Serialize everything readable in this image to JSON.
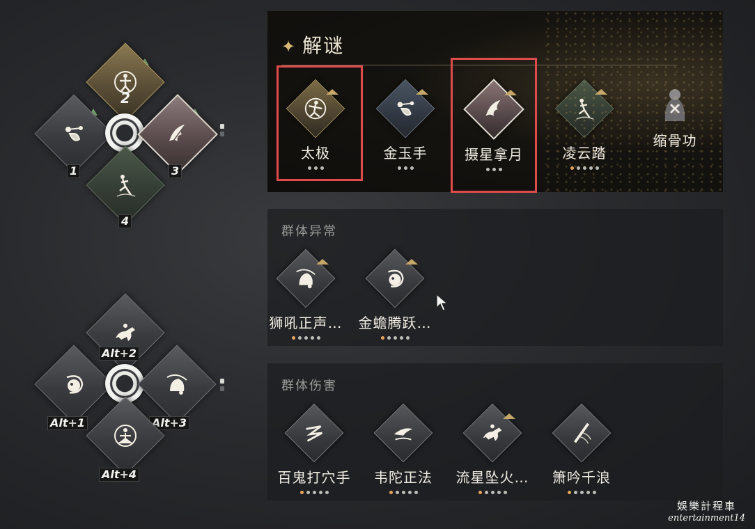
{
  "wheel_top": {
    "slots": [
      {
        "key": "2",
        "icon": "archer-icon",
        "style": "gold"
      },
      {
        "key": "1",
        "icon": "grab-hand-icon",
        "style": "grey"
      },
      {
        "key": "3",
        "icon": "feather-wing-icon",
        "style": "rose"
      },
      {
        "key": "4",
        "icon": "leap-figure-icon",
        "style": "green"
      }
    ]
  },
  "wheel_bottom": {
    "slots": [
      {
        "mod": "Alt",
        "plus": "+",
        "key": "2",
        "icon": "horse-rider-icon"
      },
      {
        "mod": "Alt",
        "plus": "+",
        "key": "1",
        "icon": "spiral-spirit-icon"
      },
      {
        "mod": "Alt",
        "plus": "+",
        "key": "3",
        "icon": "bell-roar-icon"
      },
      {
        "mod": "Alt",
        "plus": "+",
        "key": "4",
        "icon": "seated-monk-icon"
      }
    ]
  },
  "puzzle": {
    "title": "解谜",
    "skills": [
      {
        "name": "太极",
        "icon": "taichi-figure-icon",
        "style": "gold",
        "dots": 3,
        "lit": 0,
        "highlighted": true
      },
      {
        "name": "金玉手",
        "icon": "grab-hand-icon",
        "style": "blue",
        "dots": 3,
        "lit": 0,
        "highlighted": false
      },
      {
        "name": "摄星拿月",
        "icon": "feather-wing-icon",
        "style": "rose",
        "dots": 3,
        "lit": 0,
        "highlighted": true
      },
      {
        "name": "凌云踏",
        "icon": "leap-figure-icon",
        "style": "green",
        "dots": 5,
        "lit": 1,
        "highlighted": false
      },
      {
        "name": "缩骨功",
        "icon": "bone-shrink-icon",
        "style": "grey",
        "dots": 0,
        "lit": 0,
        "highlighted": false
      }
    ]
  },
  "group_abnormal": {
    "title": "群体异常",
    "skills": [
      {
        "name": "狮吼正声…",
        "icon": "bell-roar-icon",
        "style": "grey",
        "dots": 5,
        "lit": 1
      },
      {
        "name": "金蟾腾跃…",
        "icon": "spiral-spirit-icon",
        "style": "grey",
        "dots": 5,
        "lit": 1
      }
    ]
  },
  "group_damage": {
    "title": "群体伤害",
    "skills": [
      {
        "name": "百鬼打穴手",
        "icon": "lightning-strike-icon",
        "style": "grey",
        "dots": 5,
        "lit": 1
      },
      {
        "name": "韦陀正法",
        "icon": "flying-crane-icon",
        "style": "grey",
        "dots": 5,
        "lit": 1
      },
      {
        "name": "流星坠火…",
        "icon": "horse-rider-icon",
        "style": "grey",
        "dots": 5,
        "lit": 1
      },
      {
        "name": "箫吟千浪",
        "icon": "flute-icon",
        "style": "grey",
        "dots": 5,
        "lit": 1
      }
    ]
  },
  "watermark": {
    "line1": "娛樂計程車",
    "line2": "entertainment14"
  }
}
